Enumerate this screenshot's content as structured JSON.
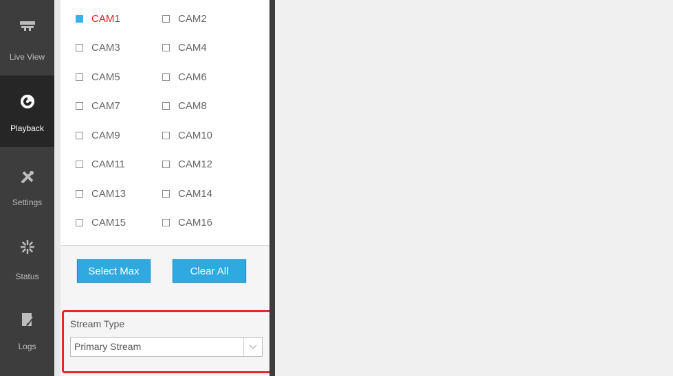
{
  "sidebar": {
    "items": [
      {
        "label": "Live View",
        "icon": "live-view-icon"
      },
      {
        "label": "Playback",
        "icon": "playback-icon"
      },
      {
        "label": "Settings",
        "icon": "settings-icon"
      },
      {
        "label": "Status",
        "icon": "status-icon"
      },
      {
        "label": "Logs",
        "icon": "logs-icon"
      }
    ],
    "active": "Playback"
  },
  "cameras": [
    {
      "label": "CAM1",
      "checked": true
    },
    {
      "label": "CAM2",
      "checked": false
    },
    {
      "label": "CAM3",
      "checked": false
    },
    {
      "label": "CAM4",
      "checked": false
    },
    {
      "label": "CAM5",
      "checked": false
    },
    {
      "label": "CAM6",
      "checked": false
    },
    {
      "label": "CAM7",
      "checked": false
    },
    {
      "label": "CAM8",
      "checked": false
    },
    {
      "label": "CAM9",
      "checked": false
    },
    {
      "label": "CAM10",
      "checked": false
    },
    {
      "label": "CAM11",
      "checked": false
    },
    {
      "label": "CAM12",
      "checked": false
    },
    {
      "label": "CAM13",
      "checked": false
    },
    {
      "label": "CAM14",
      "checked": false
    },
    {
      "label": "CAM15",
      "checked": false
    },
    {
      "label": "CAM16",
      "checked": false
    }
  ],
  "buttons": {
    "select_max": "Select Max",
    "clear_all": "Clear All"
  },
  "stream": {
    "label": "Stream Type",
    "value": "Primary Stream"
  },
  "colors": {
    "accent": "#2fa9e0",
    "highlight": "#e02a2a",
    "sidebar": "#3d3d3d"
  }
}
